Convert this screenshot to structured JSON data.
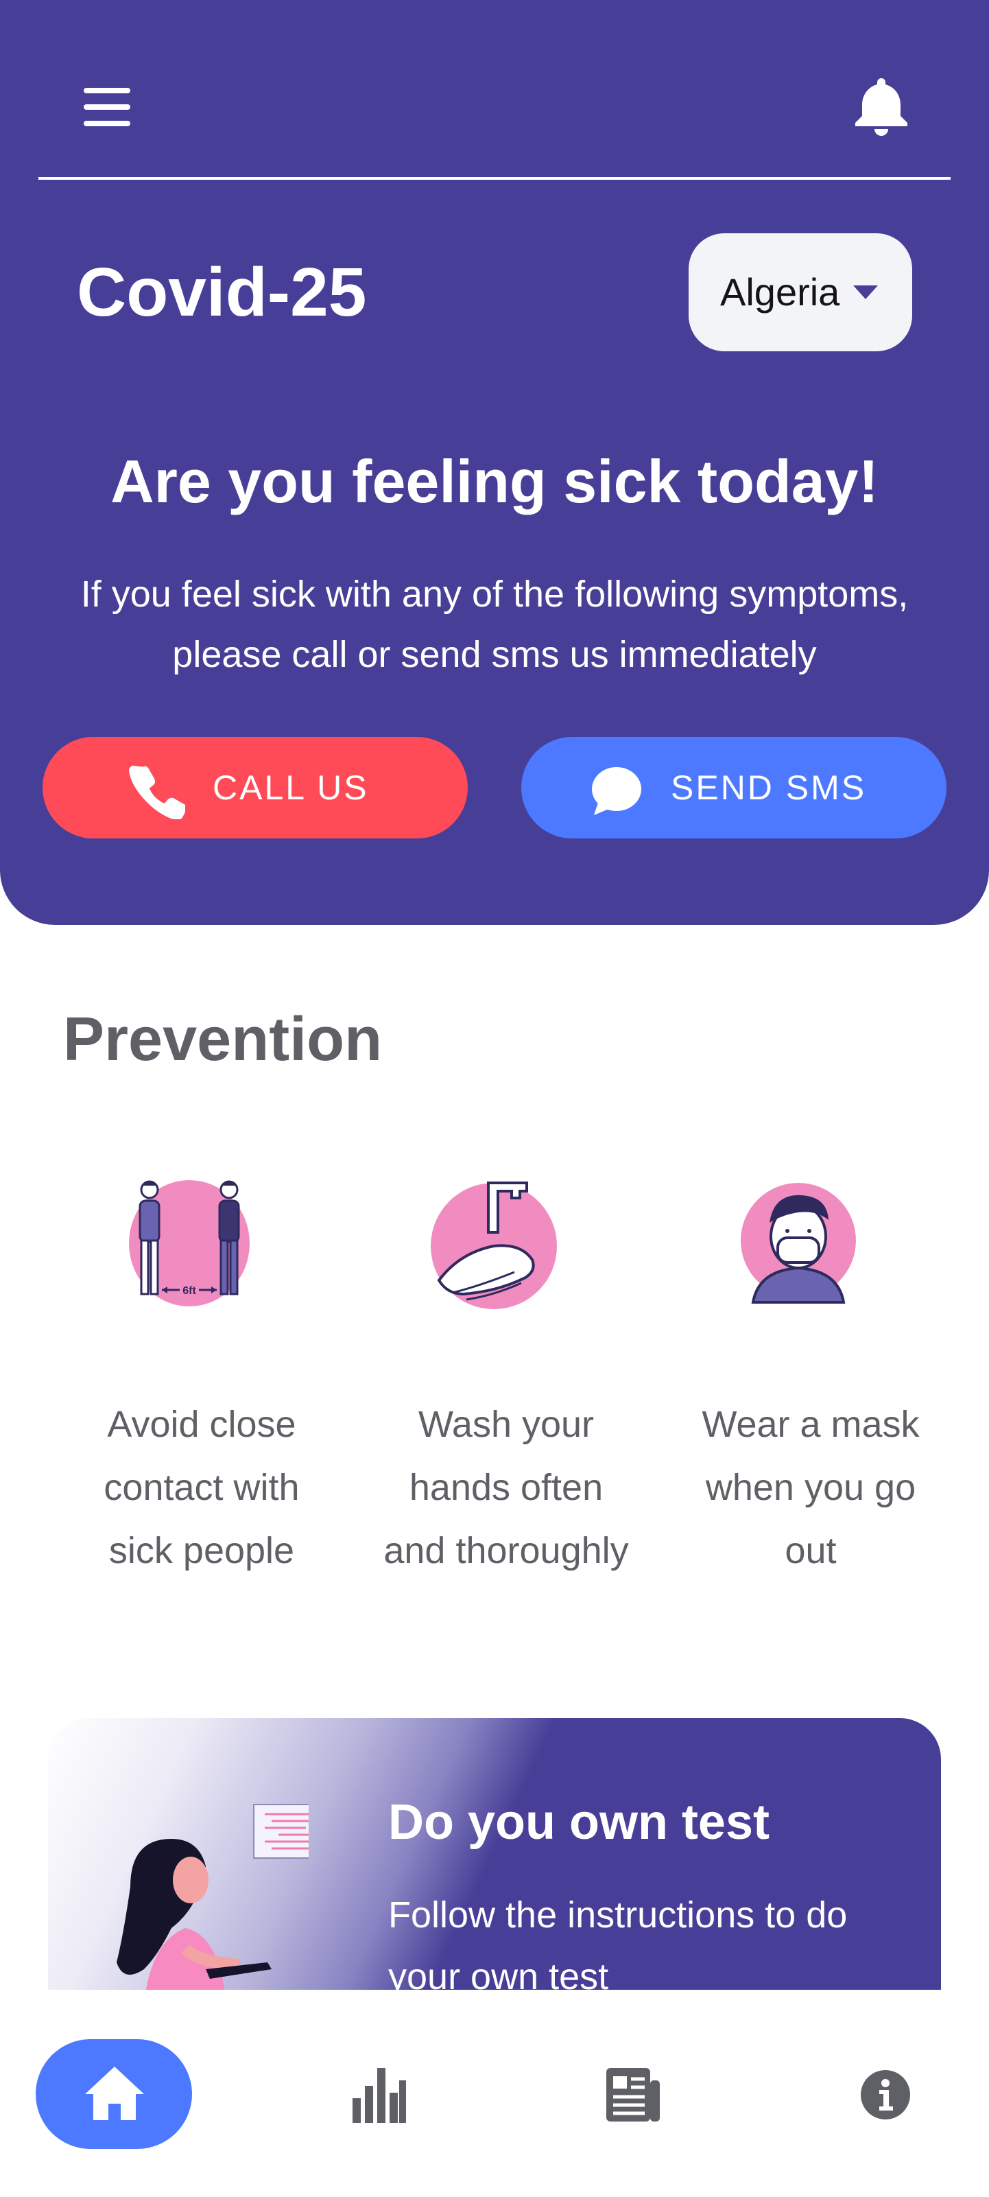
{
  "app": {
    "title": "Covid-25"
  },
  "header": {
    "country": "Algeria",
    "headline": "Are you feeling sick today!",
    "subtext_line1": "If you feel sick with any of the following symptoms,",
    "subtext_line2": "please call or send sms us immediately",
    "call_label": "CALL US",
    "sms_label": "SEND SMS"
  },
  "prevention": {
    "title": "Prevention",
    "items": [
      {
        "line1": "Avoid close",
        "line2": "contact with",
        "line3": "sick people",
        "image_caption": "6ft"
      },
      {
        "line1": "Wash your",
        "line2": "hands often",
        "line3": "and thoroughly"
      },
      {
        "line1": "Wear a mask",
        "line2": "when you go",
        "line3": "out"
      }
    ]
  },
  "test_card": {
    "title": "Do you own test",
    "desc_line1": "Follow the instructions to do",
    "desc_line2": "your own test"
  },
  "bottom_nav": {
    "items": [
      {
        "icon": "home-icon",
        "active": true
      },
      {
        "icon": "bar-chart-icon",
        "active": false
      },
      {
        "icon": "news-icon",
        "active": false
      },
      {
        "icon": "info-icon",
        "active": false
      }
    ]
  },
  "colors": {
    "primary": "#473f97",
    "call": "#ff4b57",
    "sms": "#4c79ff",
    "accent_pink": "#f88fc6",
    "text_gray": "#5f6065"
  }
}
